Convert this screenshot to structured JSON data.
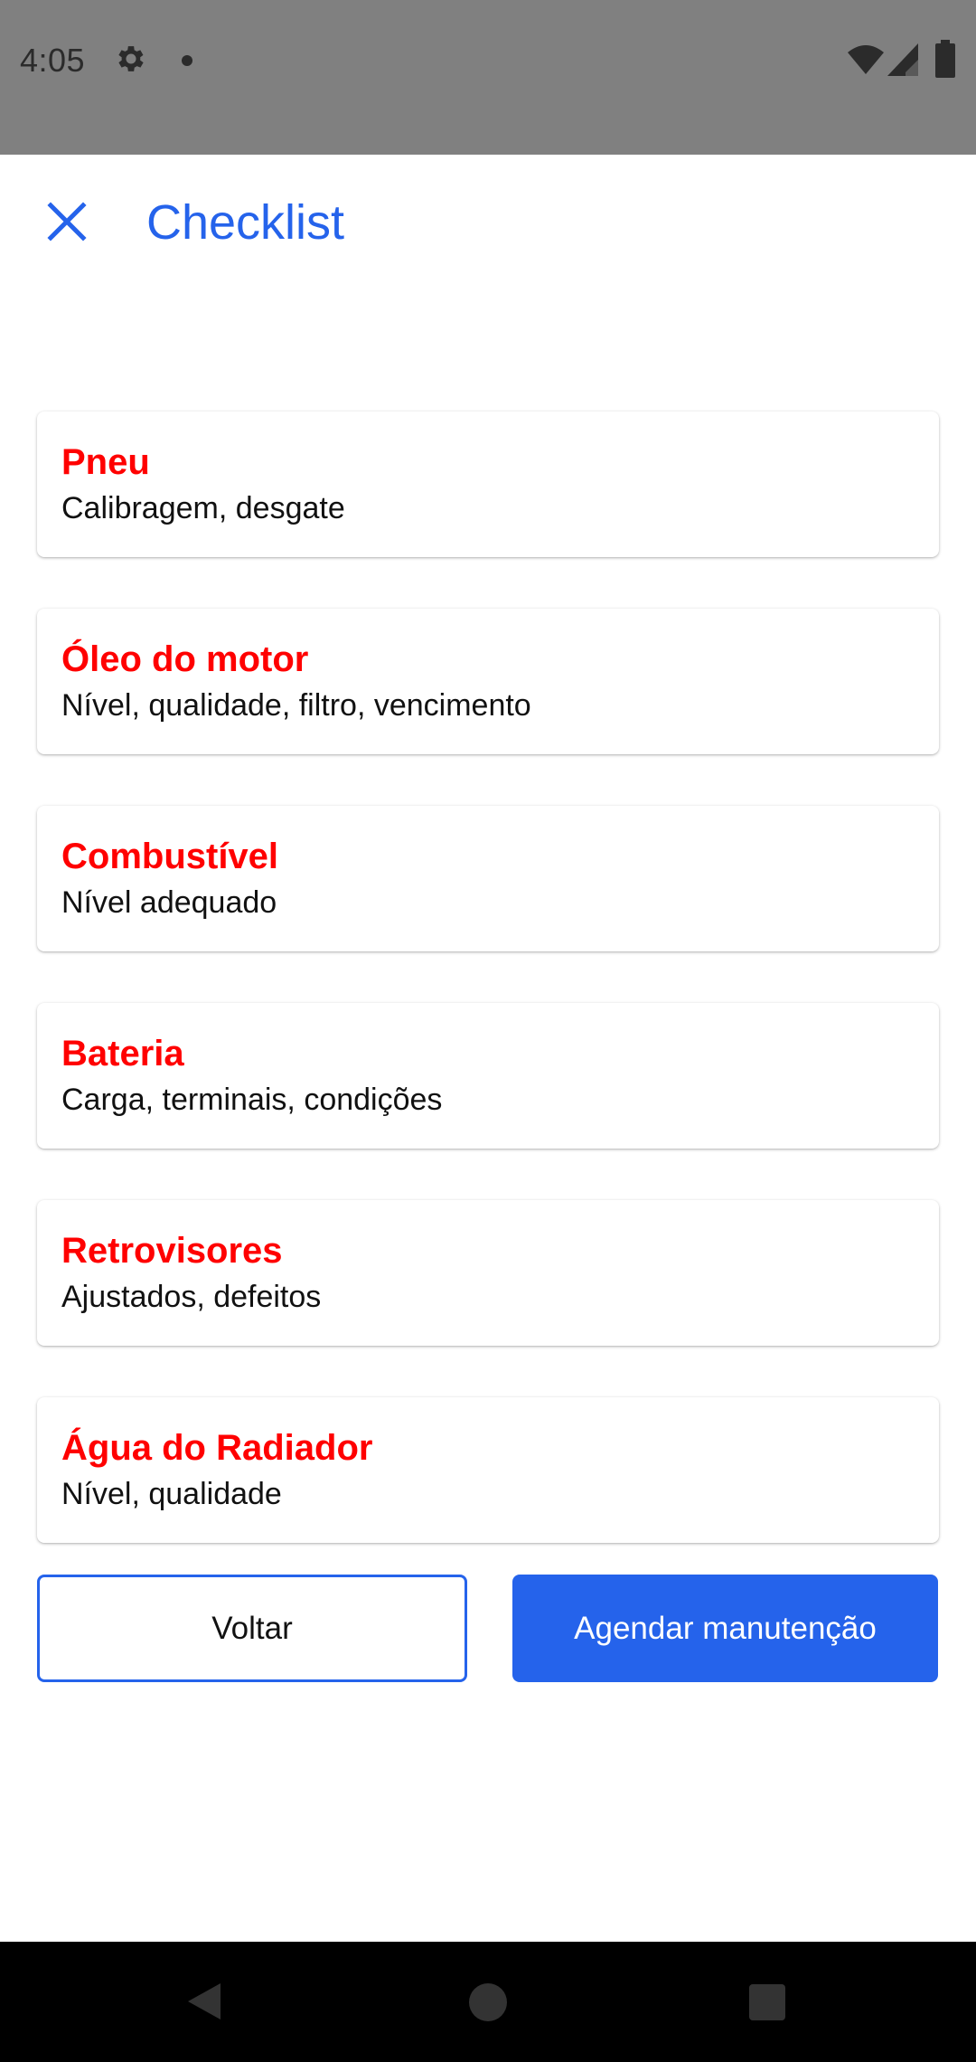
{
  "status_bar": {
    "time": "4:05",
    "icons": [
      "gear-icon",
      "notification-dot-icon",
      "wifi-icon",
      "signal-icon",
      "battery-icon"
    ]
  },
  "app_bar": {
    "close_icon": "close-icon",
    "title": "Checklist"
  },
  "colors": {
    "accent": "#2563eb",
    "item_title": "#ff0000",
    "status_bar": "#808080",
    "nav_bar": "#000000"
  },
  "checklist": [
    {
      "title": "Pneu",
      "subtitle": "Calibragem, desgate"
    },
    {
      "title": "Óleo do motor",
      "subtitle": "Nível, qualidade, filtro, vencimento"
    },
    {
      "title": "Combustível",
      "subtitle": "Nível adequado"
    },
    {
      "title": "Bateria",
      "subtitle": "Carga, terminais, condições"
    },
    {
      "title": "Retrovisores",
      "subtitle": "Ajustados, defeitos"
    },
    {
      "title": "Água do Radiador",
      "subtitle": "Nível, qualidade"
    }
  ],
  "actions": {
    "back_label": "Voltar",
    "schedule_label": "Agendar manutenção"
  },
  "nav_bar": {
    "icons": [
      "back-triangle-icon",
      "home-circle-icon",
      "recents-square-icon"
    ]
  }
}
